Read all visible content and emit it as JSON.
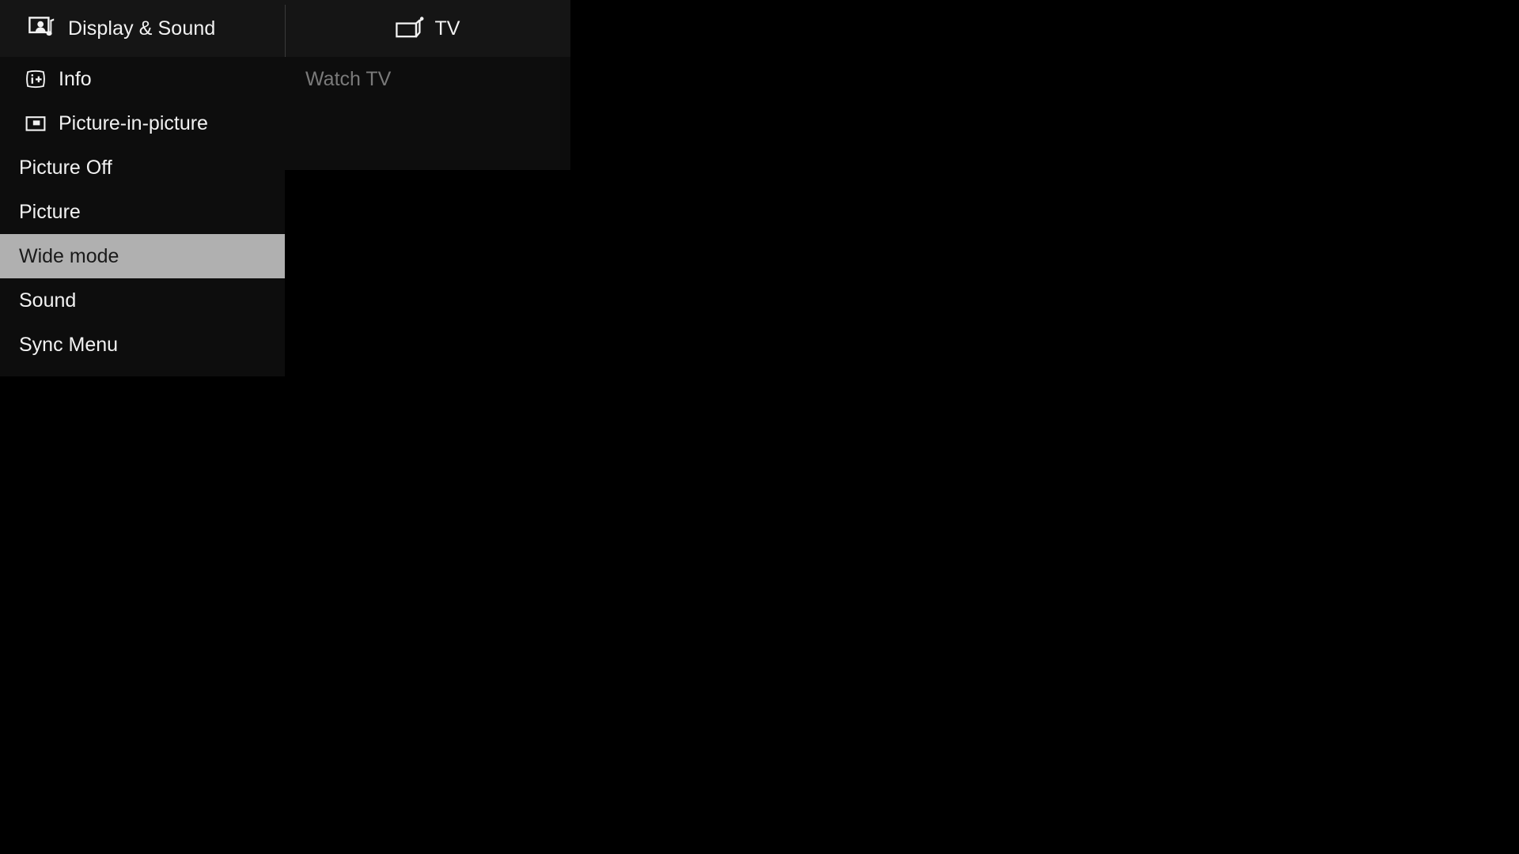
{
  "panels": {
    "left": {
      "header": {
        "label": "Display & Sound",
        "icon": "display-sound-icon"
      },
      "items": [
        {
          "label": "Info",
          "icon": "info-icon",
          "selected": false
        },
        {
          "label": "Picture-in-picture",
          "icon": "picture-in-picture-icon",
          "selected": false
        },
        {
          "label": "Picture Off",
          "icon": null,
          "selected": false
        },
        {
          "label": "Picture",
          "icon": null,
          "selected": false
        },
        {
          "label": "Wide mode",
          "icon": null,
          "selected": true
        },
        {
          "label": "Sound",
          "icon": null,
          "selected": false
        },
        {
          "label": "Sync Menu",
          "icon": null,
          "selected": false
        }
      ]
    },
    "right": {
      "header": {
        "label": "TV",
        "icon": "tv-icon"
      },
      "items": [
        {
          "label": "Watch TV",
          "icon": null,
          "selected": false,
          "disabled": true
        }
      ]
    }
  },
  "colors": {
    "screen_background": "#000000",
    "panel_background": "#0d0d0d",
    "header_background": "#151515",
    "selection_background": "#b0b0b0",
    "selection_text": "#1a1a1a",
    "primary_text": "#f2f2f2",
    "disabled_text": "#7a7a7a",
    "divider": "#3a3a3a"
  }
}
